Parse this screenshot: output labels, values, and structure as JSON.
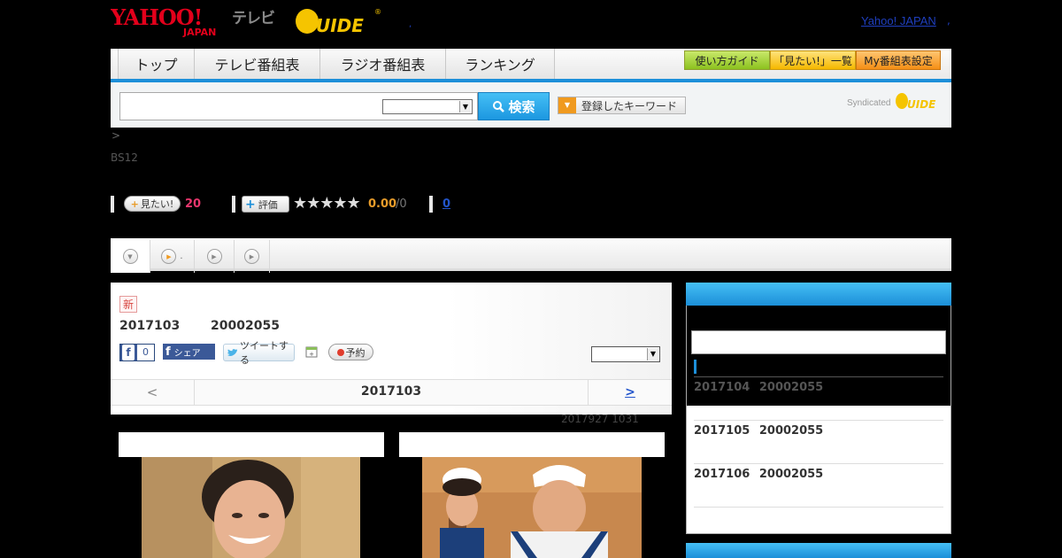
{
  "header": {
    "logo_yahoo": "YAHOO! JAPAN",
    "logo_tv": "テレビ",
    "logo_gguide": "G-GUIDE",
    "yahoo_link": "Yahoo! JAPAN",
    "dot_mid": ",",
    "dot_right": ","
  },
  "nav": {
    "tabs": [
      "トップ",
      "テレビ番組表",
      "ラジオ番組表",
      "ランキング"
    ],
    "buttons": [
      "使い方ガイド",
      "「見たい!」一覧",
      "My番組表設定"
    ]
  },
  "search": {
    "button_label": "検索",
    "keyword_button": "登録したキーワード",
    "syndicated": "Syndicated"
  },
  "breadcrumb": ">",
  "channel": "BS12",
  "rating": {
    "mitai_label": "見たい!",
    "mitai_count": "20",
    "hyoka_label": "評価",
    "stars": "★★★★★",
    "score": "0.00",
    "score_max": "/0",
    "review_count": "0"
  },
  "tabs": {
    "second_label": "."
  },
  "program": {
    "new_badge": "新",
    "date": "2017103",
    "number": "20002055",
    "fb_like_count": "0",
    "fb_share": "シェア",
    "tweet": "ツイートする",
    "reserve": "予約",
    "pager_prev": "<",
    "pager_current": "2017103",
    "pager_next": ">",
    "updated": "2017927  1031"
  },
  "sidebar": {
    "items": [
      {
        "date": "2017104",
        "number": "20002055"
      },
      {
        "date": "2017105",
        "number": "20002055"
      },
      {
        "date": "2017106",
        "number": "20002055"
      }
    ]
  },
  "colors": {
    "accent_blue": "#1d8fd9",
    "pink": "#e8366d",
    "orange": "#e89c2a",
    "link": "#2255cc"
  }
}
